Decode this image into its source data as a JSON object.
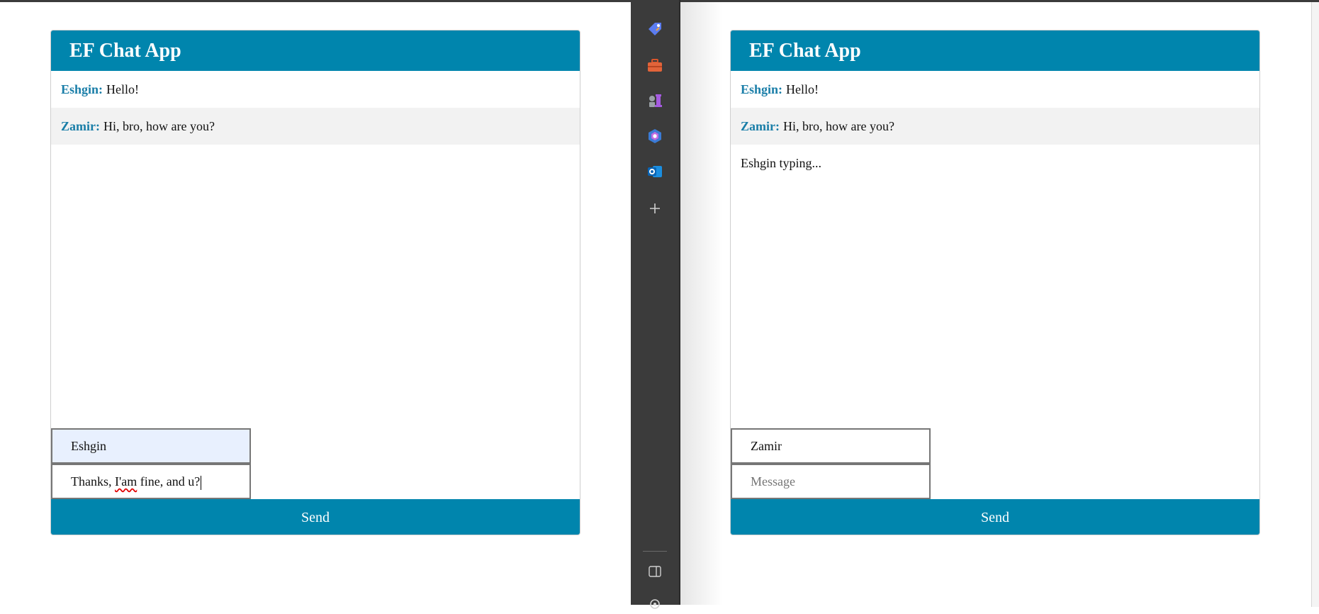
{
  "left_chat": {
    "title": "EF Chat App",
    "messages": [
      {
        "sender": "Eshgin:",
        "text": "Hello!"
      },
      {
        "sender": "Zamir:",
        "text": "Hi, bro, how are you?"
      }
    ],
    "name_value": "Eshgin",
    "message_value_pre": "Thanks, ",
    "message_value_spell": "I'am",
    "message_value_post": " fine, and u?",
    "send_label": "Send"
  },
  "right_chat": {
    "title": "EF Chat App",
    "messages": [
      {
        "sender": "Eshgin:",
        "text": "Hello!"
      },
      {
        "sender": "Zamir:",
        "text": "Hi, bro, how are you?"
      }
    ],
    "typing_text": "Eshgin typing...",
    "name_value": "Zamir",
    "message_placeholder": "Message",
    "send_label": "Send"
  },
  "sidebar": {
    "icons": [
      "tag-icon",
      "toolbox-icon",
      "chess-icon",
      "copilot-icon",
      "outlook-icon",
      "add-icon",
      "sidebar-toggle-icon",
      "settings-icon"
    ]
  },
  "colors": {
    "header_bg": "#0085ad",
    "send_bg": "#0085ad",
    "sender_color": "#1a7ea8",
    "sidebar_bg": "#3b3b3b",
    "name_autofill_bg": "#e8f0fe"
  }
}
